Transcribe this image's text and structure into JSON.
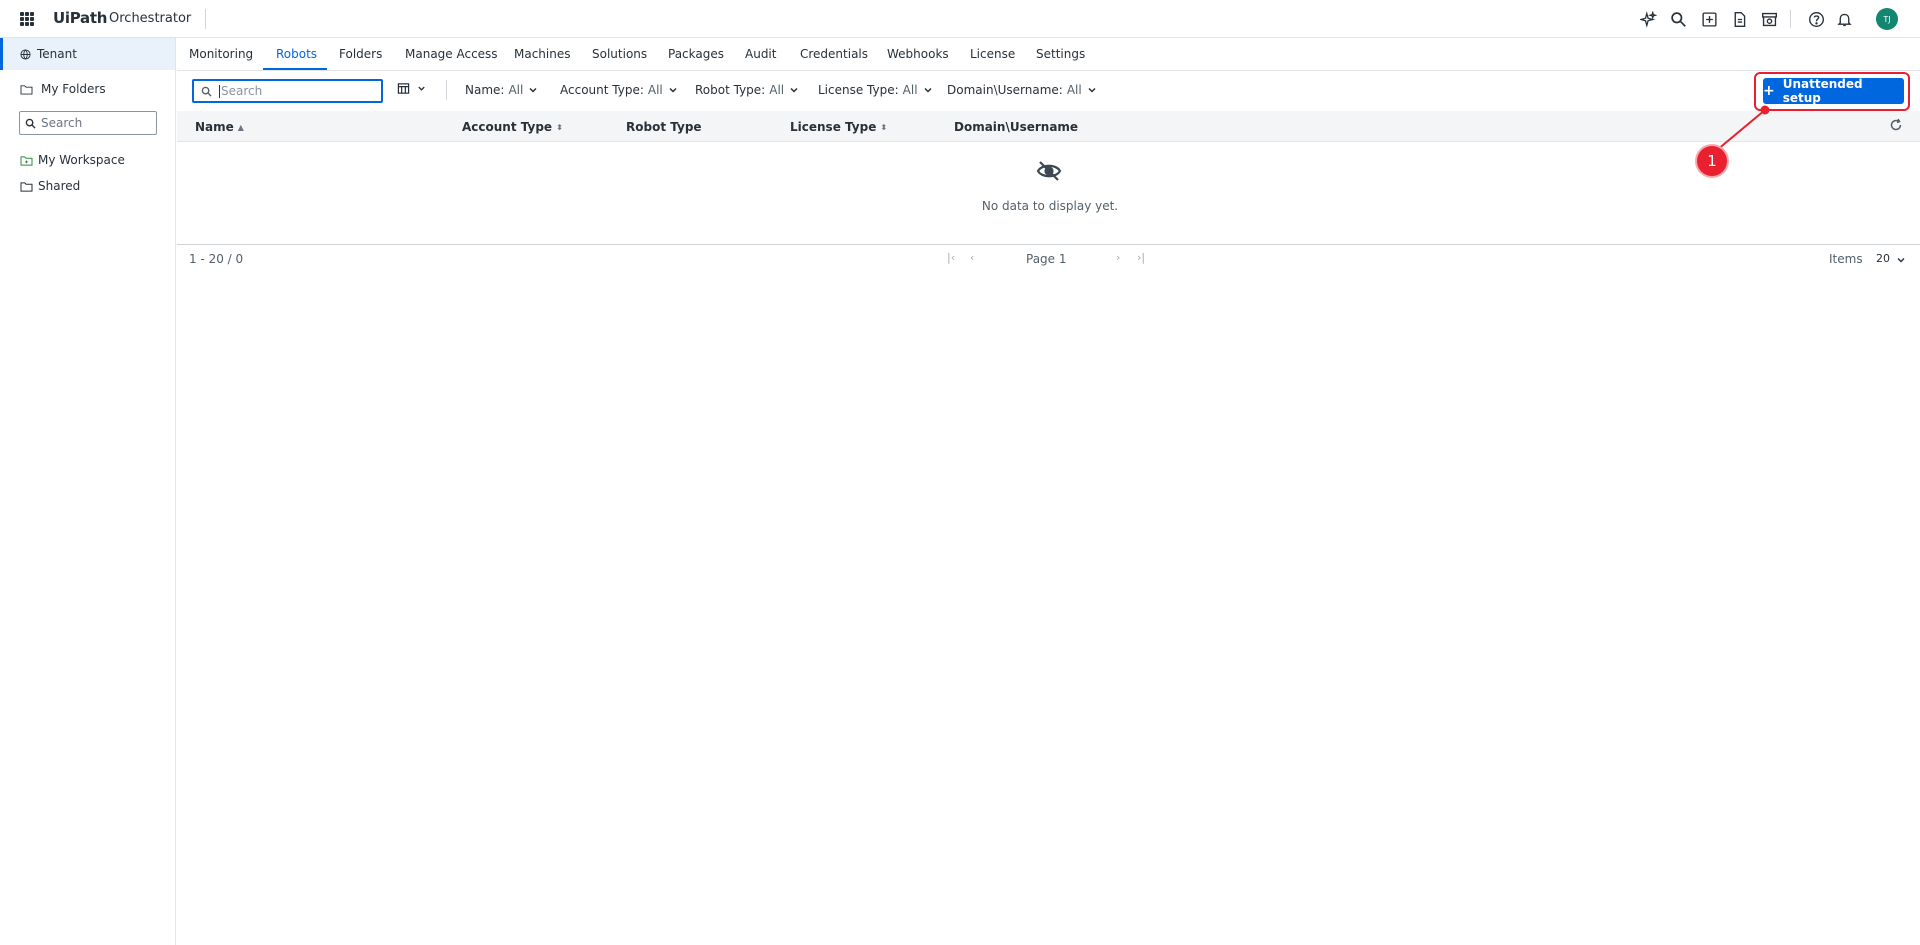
{
  "header": {
    "logo_ui": "Ui",
    "logo_path": "Path",
    "product": "Orchestrator",
    "avatar_initials": "TJ",
    "icons": [
      "apps-grid-icon",
      "autopilot-sparkle-icon",
      "search-icon",
      "add-box-icon",
      "document-icon",
      "store-icon",
      "help-icon",
      "bell-icon"
    ]
  },
  "sidebar": {
    "tenant": "Tenant",
    "my_folders": "My Folders",
    "search_placeholder": "Search",
    "items": [
      {
        "label": "My Workspace",
        "icon": "workspace-folder-icon"
      },
      {
        "label": "Shared",
        "icon": "folder-icon"
      }
    ]
  },
  "tabs": [
    {
      "label": "Monitoring"
    },
    {
      "label": "Robots",
      "active": true
    },
    {
      "label": "Folders"
    },
    {
      "label": "Manage Access"
    },
    {
      "label": "Machines"
    },
    {
      "label": "Solutions"
    },
    {
      "label": "Packages"
    },
    {
      "label": "Audit"
    },
    {
      "label": "Credentials"
    },
    {
      "label": "Webhooks"
    },
    {
      "label": "License"
    },
    {
      "label": "Settings"
    }
  ],
  "filters": {
    "search_placeholder": "Search",
    "items": [
      {
        "label": "Name:",
        "value": "All"
      },
      {
        "label": "Account Type:",
        "value": "All"
      },
      {
        "label": "Robot Type:",
        "value": "All"
      },
      {
        "label": "License Type:",
        "value": "All"
      },
      {
        "label": "Domain\\Username:",
        "value": "All"
      }
    ]
  },
  "primary_button": {
    "plus": "+",
    "label": "Unattended setup"
  },
  "table": {
    "columns": [
      "Name",
      "Account Type",
      "Robot Type",
      "License Type",
      "Domain\\Username"
    ],
    "empty_text": "No data to display yet."
  },
  "pagination": {
    "range": "1 - 20 / 0",
    "page": "Page 1",
    "items_label": "Items",
    "items_value": "20"
  },
  "annotation": {
    "number": "1"
  },
  "colors": {
    "accent": "#0067df",
    "annotation": "#e8202f",
    "avatar": "#13866f"
  }
}
